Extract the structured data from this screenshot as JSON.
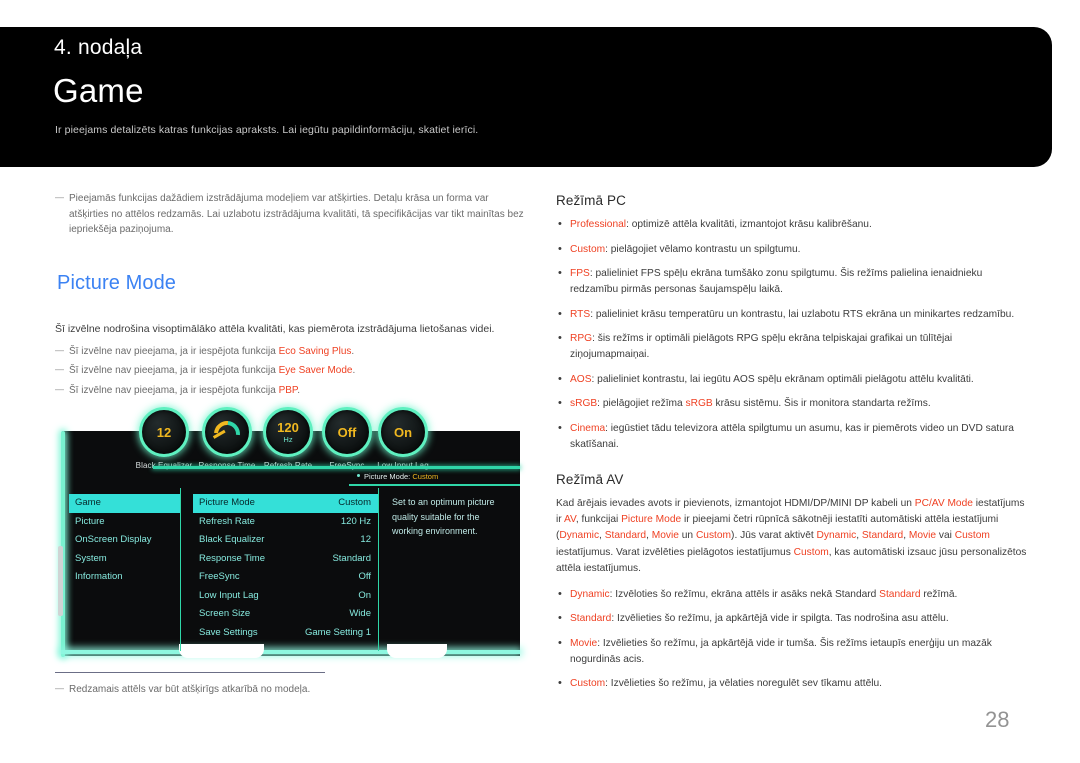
{
  "header": {
    "chapter": "4. nodaļa",
    "title": "Game",
    "subtitle": "Ir pieejams detalizēts katras funkcijas apraksts. Lai iegūtu papildinformāciju, skatiet ierīci."
  },
  "colors": {
    "accent_blue": "#3b82f3",
    "accent_red": "#ef4123",
    "osd_cyan": "#2fd6a8",
    "osd_highlight": "#34e0d8",
    "osd_yellow": "#f0b820",
    "header_bg": "#000000"
  },
  "left": {
    "top_note": "Pieejamās funkcijas dažādiem izstrādājuma modeļiem var atšķirties. Detaļu krāsa un forma var atšķirties no attēlos redzamās. Lai uzlabotu izstrādājuma kvalitāti, tā specifikācijas var tikt mainītas bez iepriekšēja paziņojuma.",
    "section_heading": "Picture Mode",
    "lead": "Šī izvēlne nodrošina visoptimālāko attēla kvalitāti, kas piemērota izstrādājuma lietošanas videi.",
    "notes": [
      {
        "prefix": "Šī izvēlne nav pieejama, ja ir iespējota funkcija ",
        "accent": "Eco Saving Plus",
        "suffix": "."
      },
      {
        "prefix": "Šī izvēlne nav pieejama, ja ir iespējota funkcija ",
        "accent": "Eye Saver Mode",
        "suffix": "."
      },
      {
        "prefix": "Šī izvēlne nav pieejama, ja ir iespējota funkcija ",
        "accent": "PBP",
        "suffix": "."
      }
    ]
  },
  "osd": {
    "gauges": [
      {
        "value": "12",
        "unit": "",
        "label": "Black Equalizer",
        "type": "value"
      },
      {
        "value": "",
        "unit": "",
        "label": "Response Time",
        "type": "dial"
      },
      {
        "value": "120",
        "unit": "Hz",
        "label": "Refresh Rate",
        "type": "value"
      },
      {
        "value": "Off",
        "unit": "",
        "label": "FreeSync",
        "type": "value"
      },
      {
        "value": "On",
        "unit": "",
        "label": "Low Input Lag",
        "type": "value"
      }
    ],
    "indicator": {
      "label": "Picture Mode:",
      "value": "Custom"
    },
    "nav": [
      {
        "label": "Game",
        "selected": true
      },
      {
        "label": "Picture",
        "selected": false
      },
      {
        "label": "OnScreen Display",
        "selected": false
      },
      {
        "label": "System",
        "selected": false
      },
      {
        "label": "Information",
        "selected": false
      }
    ],
    "settings": [
      {
        "label": "Picture Mode",
        "value": "Custom",
        "selected": true
      },
      {
        "label": "Refresh Rate",
        "value": "120 Hz",
        "selected": false
      },
      {
        "label": "Black Equalizer",
        "value": "12",
        "selected": false
      },
      {
        "label": "Response Time",
        "value": "Standard",
        "selected": false
      },
      {
        "label": "FreeSync",
        "value": "Off",
        "selected": false
      },
      {
        "label": "Low Input Lag",
        "value": "On",
        "selected": false
      },
      {
        "label": "Screen Size",
        "value": "Wide",
        "selected": false
      },
      {
        "label": "Save Settings",
        "value": "Game Setting 1",
        "selected": false
      }
    ],
    "description": "Set to an optimum picture quality suitable for the working environment."
  },
  "footer": {
    "note": "Redzamais attēls var būt atšķirīgs atkarībā no modeļa.",
    "page_number": "28"
  },
  "right": {
    "pc_title": "Režīmā PC",
    "pc_items": [
      {
        "term": "Professional",
        "text": ": optimizē attēla kvalitāti, izmantojot krāsu kalibrēšanu."
      },
      {
        "term": "Custom",
        "text": ": pielāgojiet vēlamo kontrastu un spilgtumu."
      },
      {
        "term": "FPS",
        "text": ": palieliniet FPS spēļu ekrāna tumšāko zonu spilgtumu. Šis režīms palielina ienaidnieku redzamību pirmās personas šaujamspēļu laikā."
      },
      {
        "term": "RTS",
        "text": ": palieliniet krāsu temperatūru un kontrastu, lai uzlabotu RTS ekrāna un minikartes redzamību."
      },
      {
        "term": "RPG",
        "text": ": šis režīms ir optimāli pielāgots RPG spēļu ekrāna telpiskajai grafikai un tūlītējai ziņojumapmaiņai."
      },
      {
        "term": "AOS",
        "text": ": palieliniet kontrastu, lai iegūtu AOS spēļu ekrānam optimāli pielāgotu attēlu kvalitāti."
      },
      {
        "term": "sRGB",
        "text": ": pielāgojiet režīma ",
        "term2": "sRGB",
        "text2": " krāsu sistēmu. Šis ir monitora standarta režīms."
      },
      {
        "term": "Cinema",
        "text": ": iegūstiet tādu televizora attēla spilgtumu un asumu, kas ir piemērots video un DVD satura skatīšanai."
      }
    ],
    "av_title": "Režīmā AV",
    "av_paragraph_parts": [
      {
        "t": "Kad ārējais ievades avots ir pievienots, izmantojot HDMI/DP/MINI DP kabeli un ",
        "a": false
      },
      {
        "t": "PC/AV Mode",
        "a": true
      },
      {
        "t": " iestatījums ir ",
        "a": false
      },
      {
        "t": "AV",
        "a": true
      },
      {
        "t": ", funkcijai ",
        "a": false
      },
      {
        "t": "Picture Mode",
        "a": true
      },
      {
        "t": " ir pieejami četri rūpnīcā sākotnēji iestatīti automātiski attēla iestatījumi (",
        "a": false
      },
      {
        "t": "Dynamic",
        "a": true
      },
      {
        "t": ", ",
        "a": false
      },
      {
        "t": "Standard",
        "a": true
      },
      {
        "t": ", ",
        "a": false
      },
      {
        "t": "Movie",
        "a": true
      },
      {
        "t": " un ",
        "a": false
      },
      {
        "t": "Custom",
        "a": true
      },
      {
        "t": "). Jūs varat aktivēt ",
        "a": false
      },
      {
        "t": "Dynamic",
        "a": true
      },
      {
        "t": ", ",
        "a": false
      },
      {
        "t": "Standard",
        "a": true
      },
      {
        "t": ", ",
        "a": false
      },
      {
        "t": "Movie",
        "a": true
      },
      {
        "t": " vai ",
        "a": false
      },
      {
        "t": "Custom",
        "a": true
      },
      {
        "t": " iestatījumus. Varat izvēlēties pielāgotos iestatījumus ",
        "a": false
      },
      {
        "t": "Custom",
        "a": true
      },
      {
        "t": ", kas automātiski izsauc jūsu personalizētos attēla iestatījumus.",
        "a": false
      }
    ],
    "av_items": [
      {
        "term": "Dynamic",
        "text": ": Izvēloties šo režīmu, ekrāna attēls ir asāks nekā Standard ",
        "term2": "Standard",
        "text2": " režīmā."
      },
      {
        "term": "Standard",
        "text": ": Izvēlieties šo režīmu, ja apkārtējā vide ir spilgta. Tas nodrošina asu attēlu."
      },
      {
        "term": "Movie",
        "text": ": Izvēlieties šo režīmu, ja apkārtējā vide ir tumša. Šis režīms ietaupīs enerģiju un mazāk nogurdinās acis."
      },
      {
        "term": "Custom",
        "text": ": Izvēlieties šo režīmu, ja vēlaties noregulēt sev tīkamu attēlu."
      }
    ]
  }
}
